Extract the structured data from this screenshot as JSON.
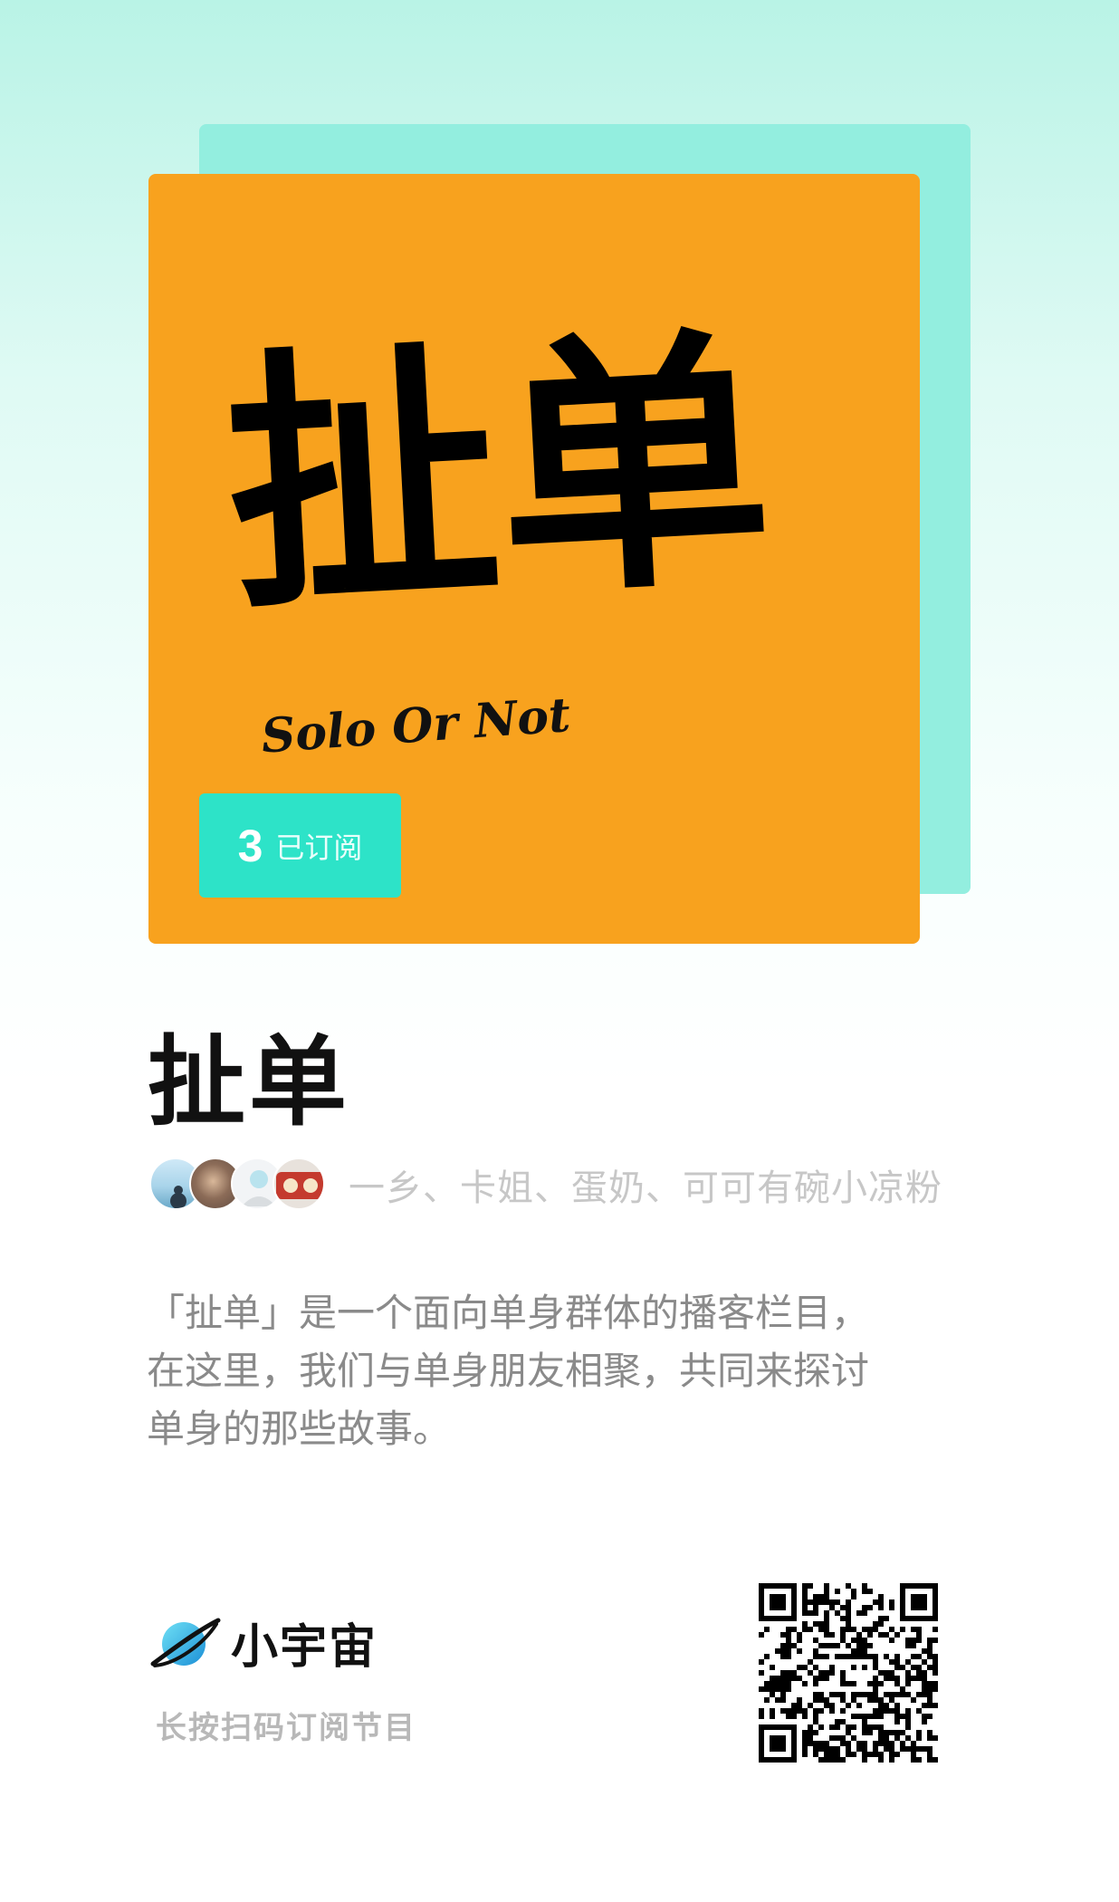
{
  "cover": {
    "title_art": "扯单",
    "subtitle_art": "Solo Or Not",
    "bg_color": "#f8a21e",
    "subscribed_count": "3",
    "subscribed_label": "已订阅"
  },
  "podcast": {
    "title": "扯单",
    "hosts": "一乡、卡姐、蛋奶、可可有碗小凉粉",
    "description_lines": [
      "「扯单」是一个面向单身群体的播客栏目，",
      "在这里，我们与单身朋友相聚，共同来探讨",
      "单身的那些故事。"
    ]
  },
  "footer": {
    "brand_name": "小宇宙",
    "scan_hint": "长按扫码订阅节目"
  },
  "icons": [
    "planet-logo-icon",
    "qr-code-icon"
  ],
  "colors": {
    "accent": "#2de3c8",
    "shadow_card": "#93eedf",
    "title_text": "#111111",
    "muted_text": "#8a8a8a"
  }
}
